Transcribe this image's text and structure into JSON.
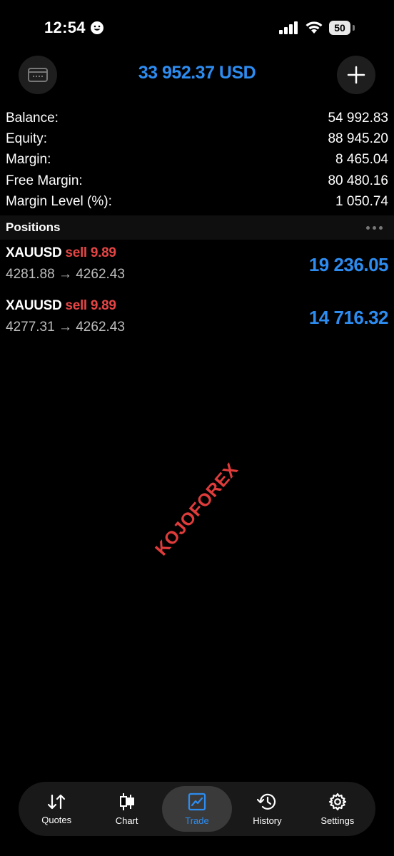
{
  "status_bar": {
    "time": "12:54",
    "battery": "50"
  },
  "header": {
    "title": "33 952.37 USD"
  },
  "summary": [
    {
      "label": "Balance:",
      "value": "54 992.83"
    },
    {
      "label": "Equity:",
      "value": "88 945.20"
    },
    {
      "label": "Margin:",
      "value": "8 465.04"
    },
    {
      "label": "Free Margin:",
      "value": "80 480.16"
    },
    {
      "label": "Margin Level (%):",
      "value": "1 050.74"
    }
  ],
  "positions_section": {
    "title": "Positions"
  },
  "positions": [
    {
      "symbol": "XAUUSD",
      "side": "sell 9.89",
      "prices": "4281.88 → 4262.43",
      "profit": "19 236.05"
    },
    {
      "symbol": "XAUUSD",
      "side": "sell 9.89",
      "prices": "4277.31 → 4262.43",
      "profit": "14 716.32"
    }
  ],
  "watermark": "KOJOFOREX",
  "tabs": [
    {
      "label": "Quotes",
      "icon": "quotes-icon"
    },
    {
      "label": "Chart",
      "icon": "chart-candles-icon"
    },
    {
      "label": "Trade",
      "icon": "trade-icon",
      "active": true
    },
    {
      "label": "History",
      "icon": "history-icon"
    },
    {
      "label": "Settings",
      "icon": "gear-icon"
    }
  ],
  "colors": {
    "accent": "#2d8cf0",
    "sell": "#e64545",
    "watermark": "#e03b3b",
    "background": "#000000"
  }
}
